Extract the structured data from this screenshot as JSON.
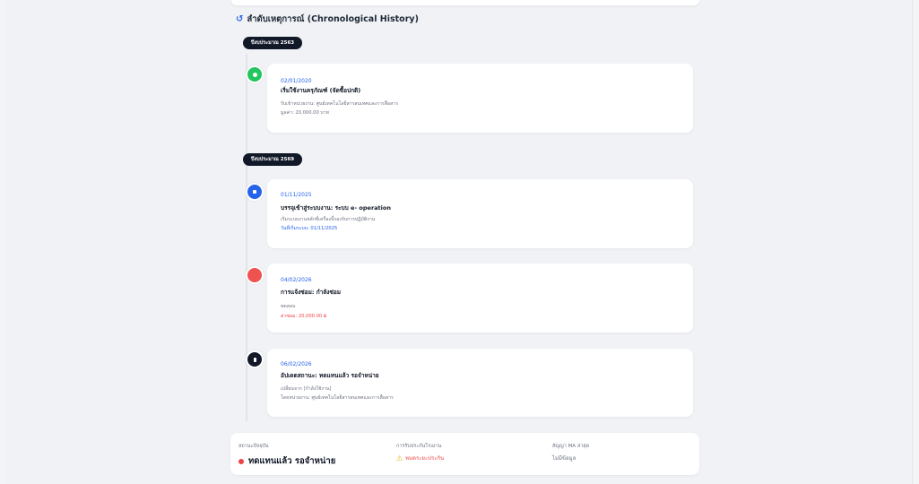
{
  "header": {
    "history_icon": "history-icon",
    "title": "ลำดับเหตุการณ์ (Chronological History)"
  },
  "timeline": {
    "groups": [
      {
        "year_label": "ปีงบประมาณ 2563"
      },
      {
        "year_label": "ปีงบประมาณ 2569"
      }
    ],
    "events": [
      {
        "icon": "gear-icon",
        "color": "#22c55e",
        "date": "02/01/2020",
        "title": "เริ่มใช้งานครุภัณฑ์ (จัดซื้อปกติ)",
        "detail_1": "รับเข้าหน่วยงาน: ศูนย์เทคโนโลยีสารสนเทศและการสื่อสาร",
        "detail_2": "มูลค่า: 20,000.00 บาท"
      },
      {
        "icon": "import-icon",
        "color": "#2563eb",
        "date": "01/11/2025",
        "title": "บรรจุเข้าสู่ระบบงาน: ระบบ e- operation",
        "detail_1": "เริ่มระบบงานหลักที่เครื่องนี้รองรับการปฏิบัติงาน",
        "detail_2": "วันที่เริ่มระบบ: 01/11/2025"
      },
      {
        "icon": "repair-icon",
        "color": "#ef5350",
        "date": "04/02/2026",
        "title": "การแจ้งซ่อม: กำลังซ่อม",
        "detail_1": "ทดสอบ",
        "detail_2": "ค่าซ่อม: 20,000.00 ฿"
      },
      {
        "icon": "document-icon",
        "color": "#111827",
        "date": "06/02/2026",
        "title": "อัปเดตสถานะ: ทดแทนแล้ว รอจำหน่าย",
        "detail_1": "เปลี่ยนจาก [กำลังใช้งาน]",
        "detail_2": "โดยหน่วยงาน: ศูนย์เทคโนโลยีสารสนเทศและการสื่อสาร"
      }
    ]
  },
  "status": {
    "current_label": "สถานะปัจจุบัน",
    "current_value": "ทดแทนแล้ว รอจำหน่าย",
    "warranty_label": "การรับประกันโรงงาน",
    "warranty_value": "หมดระยะประกัน",
    "ma_label": "สัญญา MA ล่าสุด",
    "ma_value": "ไม่มีข้อมูล"
  },
  "colors": {
    "accent": "#2563eb",
    "danger": "#ef4444",
    "warning": "#eab308",
    "badge": "#111827"
  }
}
